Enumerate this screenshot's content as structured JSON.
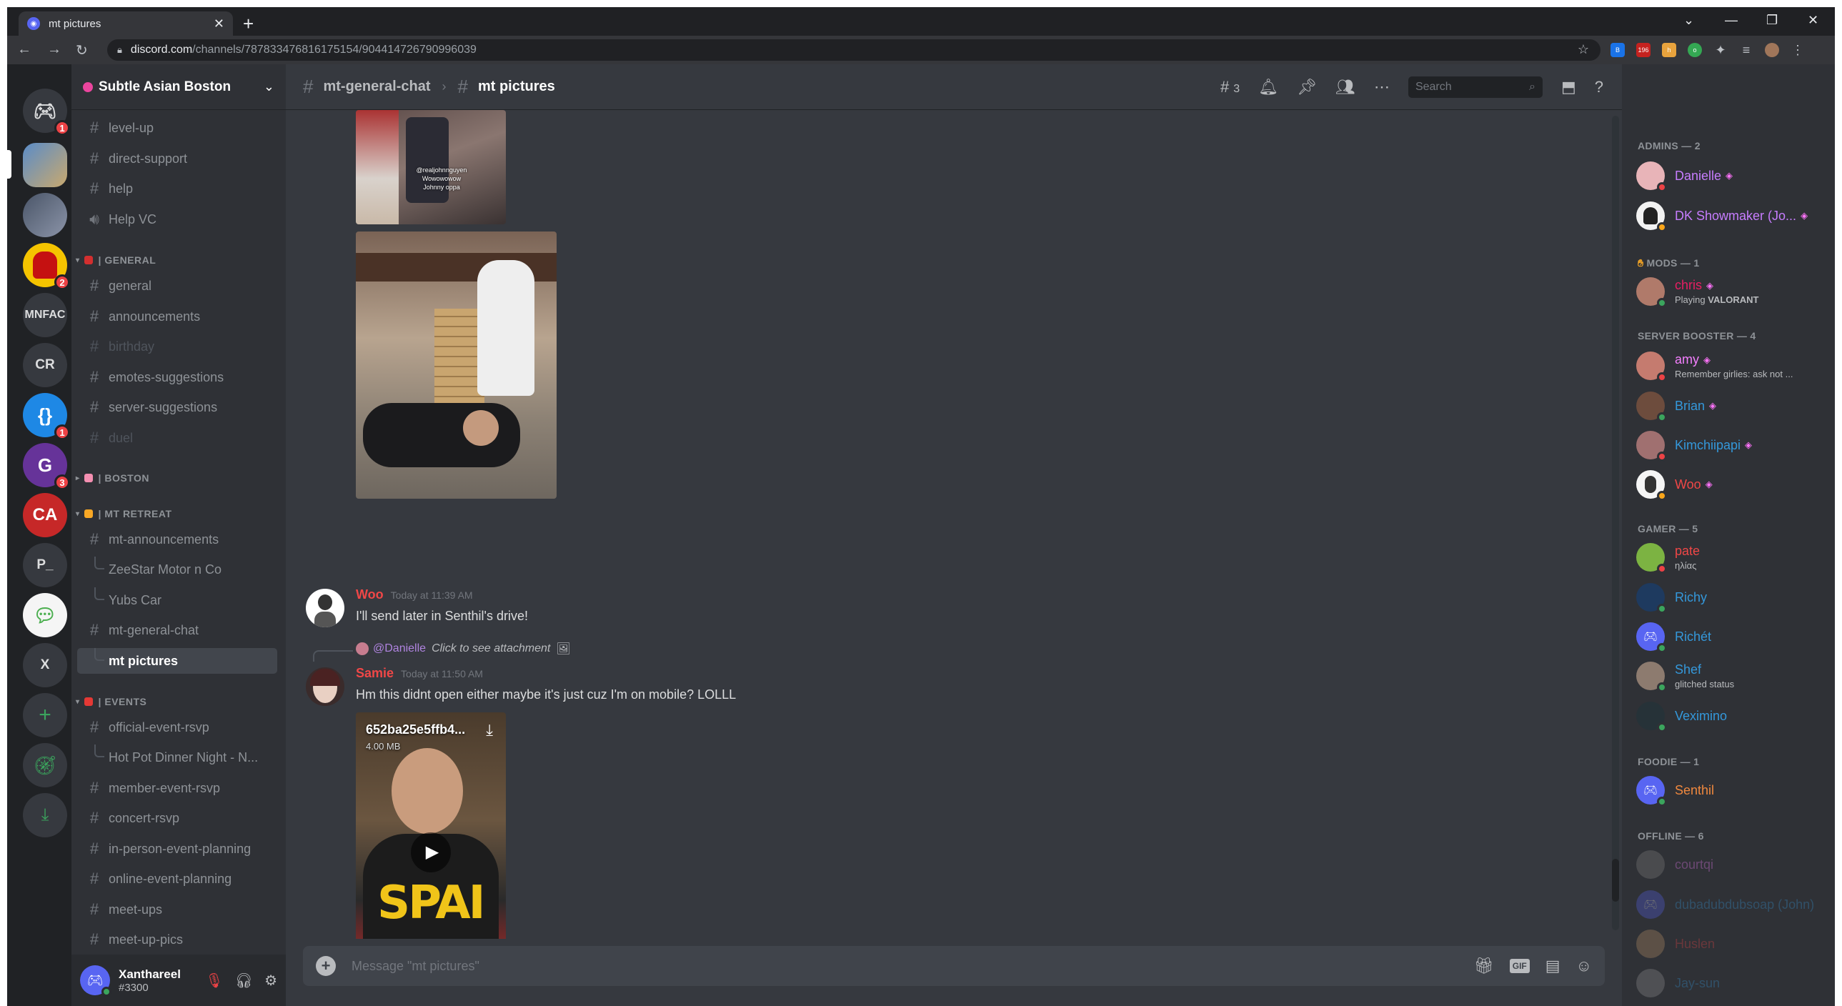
{
  "browser": {
    "tab_title": "mt pictures",
    "url_host": "discord.com",
    "url_path": "/channels/787833476816175154/904414726790996039"
  },
  "guilds": [
    {
      "name": "home",
      "badge": "1"
    },
    {
      "name": "server-2",
      "badge": ""
    },
    {
      "name": "server-3",
      "badge": ""
    },
    {
      "name": "server-amongus",
      "badge": "2"
    },
    {
      "name": "MNFAC",
      "label": "MNFAC",
      "badge": ""
    },
    {
      "name": "CR",
      "label": "CR",
      "badge": ""
    },
    {
      "name": "server-brackets",
      "badge": "1"
    },
    {
      "name": "server-gatsby",
      "badge": "3"
    },
    {
      "name": "CA",
      "label": "CA",
      "badge": ""
    },
    {
      "name": "P",
      "label": "P_",
      "badge": ""
    },
    {
      "name": "server-chat",
      "badge": ""
    },
    {
      "name": "X",
      "label": "X",
      "badge": ""
    }
  ],
  "server": {
    "name": "Subtle Asian Boston"
  },
  "channels": {
    "level_up": "level-up",
    "direct_support": "direct-support",
    "help": "help",
    "help_vc": "Help VC",
    "cat_general": "| GENERAL",
    "general": "general",
    "announcements": "announcements",
    "birthday": "birthday",
    "emotes_suggestions": "emotes-suggestions",
    "server_suggestions": "server-suggestions",
    "duel": "duel",
    "cat_boston": "| BOSTON",
    "cat_mt_retreat": "| MT RETREAT",
    "mt_announcements": "mt-announcements",
    "zeestar": "ZeeStar Motor n Co",
    "yubs_car": "Yubs Car",
    "mt_general_chat": "mt-general-chat",
    "mt_pictures": "mt pictures",
    "cat_events": "| EVENTS",
    "official_event_rsvp": "official-event-rsvp",
    "hot_pot": "Hot Pot Dinner Night - N...",
    "member_event_rsvp": "member-event-rsvp",
    "concert_rsvp": "concert-rsvp",
    "in_person_event_planning": "in-person-event-planning",
    "online_event_planning": "online-event-planning",
    "meet_ups": "meet-ups",
    "meet_up_pics": "meet-up-pics"
  },
  "user": {
    "name": "Xanthareel",
    "tag": "#3300"
  },
  "topbar": {
    "parent_channel": "mt-general-chat",
    "current_channel": "mt pictures",
    "threads_count": "3",
    "search_placeholder": "Search"
  },
  "messages": {
    "photo_caption_lines": [
      "@realjohnnguyen",
      "Wowowowow",
      "Johnny oppa"
    ],
    "woo": {
      "author": "Woo",
      "time": "Today at 11:39 AM",
      "text": "I'll send later in Senthil's drive!"
    },
    "samie": {
      "reply_to": "@Danielle",
      "reply_text": "Click to see attachment",
      "author": "Samie",
      "time": "Today at 11:50 AM",
      "text": "Hm this didnt open either maybe it's just cuz I'm on mobile? LOLLL",
      "video_name": "652ba25e5ffb4...",
      "video_size": "4.00 MB",
      "shirt_text": "SPAI"
    }
  },
  "composer": {
    "placeholder": "Message \"mt pictures\"",
    "gif_label": "GIF"
  },
  "members": {
    "cat_admins": "ADMINS — 2",
    "danielle": "Danielle",
    "dk": "DK Showmaker (Jo...",
    "cat_mods": "MODS — 1",
    "chris": "chris",
    "chris_activity_prefix": "Playing ",
    "chris_activity": "VALORANT",
    "cat_boosters": "SERVER BOOSTER — 4",
    "amy": "amy",
    "amy_status": "Remember girlies: ask not ...",
    "brian": "Brian",
    "kimchiipapi": "Kimchiipapi",
    "woo": "Woo",
    "cat_gamer": "GAMER — 5",
    "pate": "pate",
    "pate_status": "ηλίας",
    "richy": "Richy",
    "richet": "Richét",
    "shef": "Shef",
    "shef_status": "glitched status",
    "veximino": "Veximino",
    "cat_foodie": "FOODIE — 1",
    "senthil": "Senthil",
    "cat_offline": "OFFLINE — 6",
    "courtqi": "courtqi",
    "dubadub": "dubadubdubsoap (John)",
    "huslen": "Huslen",
    "jaysun": "Jay-sun"
  },
  "colors": {
    "admin": "#c77dff",
    "mod": "#e91e63",
    "booster": "#f47fff",
    "gamer": "#3498db",
    "foodie": "#f0883e",
    "woo": "#f04747",
    "samie": "#f04747"
  }
}
